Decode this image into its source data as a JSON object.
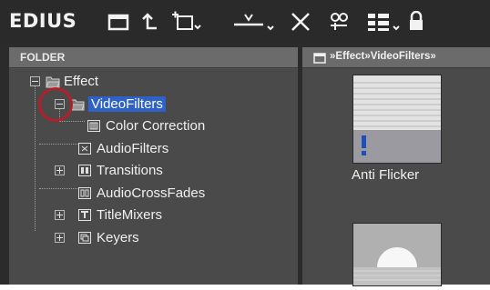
{
  "app": {
    "title": "EDIUS"
  },
  "toolbar": {
    "icons": [
      "folder-icon",
      "up-icon",
      "new-folder-icon",
      "import-icon",
      "delete-icon",
      "properties-icon",
      "view-icon",
      "lock-icon"
    ]
  },
  "folder_panel": {
    "header": "FOLDER",
    "tree": [
      {
        "label": "Effect",
        "level": 0,
        "expanded": true
      },
      {
        "label": "VideoFilters",
        "level": 1,
        "expanded": true,
        "selected": true
      },
      {
        "label": "Color Correction",
        "level": 2
      },
      {
        "label": "AudioFilters",
        "level": 1
      },
      {
        "label": "Transitions",
        "level": 1,
        "collapsed": true
      },
      {
        "label": "AudioCrossFades",
        "level": 1
      },
      {
        "label": "TitleMixers",
        "level": 1,
        "collapsed": true
      },
      {
        "label": "Keyers",
        "level": 1,
        "collapsed": true
      }
    ]
  },
  "effect_panel": {
    "path": "»Effect»VideoFilters»",
    "items": [
      {
        "label": "Anti Flicker"
      }
    ]
  },
  "colors": {
    "selection": "#2f62c8",
    "highlight_ring": "#b3202a"
  }
}
